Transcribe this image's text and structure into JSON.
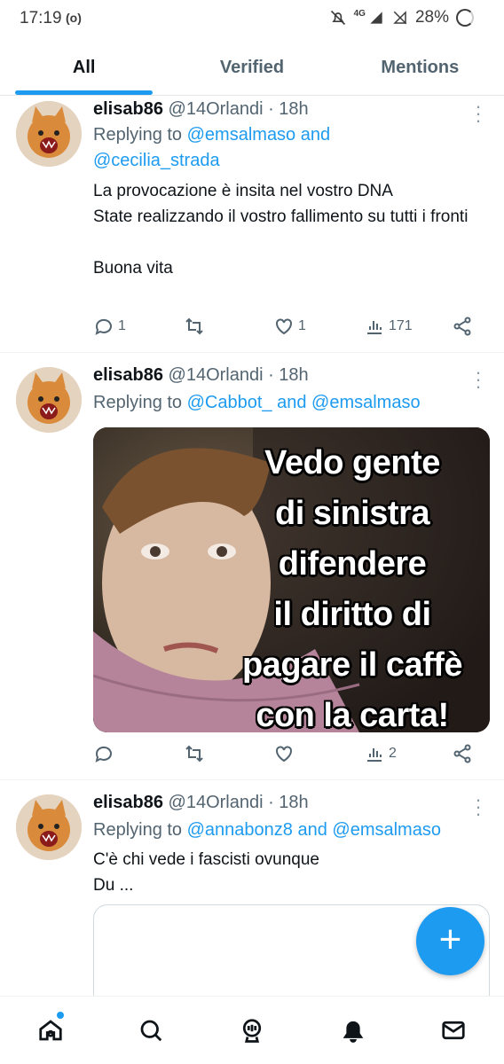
{
  "status": {
    "time": "17:19",
    "cast": "(o)",
    "network": "4G",
    "battery": "28%"
  },
  "tabs": [
    {
      "label": "All",
      "active": true
    },
    {
      "label": "Verified",
      "active": false
    },
    {
      "label": "Mentions",
      "active": false
    }
  ],
  "tweets": [
    {
      "name": "elisab86",
      "meta": "@14Orlandi · 18h",
      "replying_prefix": "Replying to",
      "mentions_line1": "@emsalmaso and",
      "mentions_line2": "@cecilia_strada",
      "text": "La provocazione è insita nel vostro DNA\nState realizzando il vostro fallimento su tutti i fronti\n\nBuona vita",
      "replies": "1",
      "retweets": "",
      "likes": "1",
      "views": "171"
    },
    {
      "name": "elisab86",
      "meta": "@14Orlandi · 18h",
      "replying_prefix": "Replying to",
      "mentions": "@Cabbot_ and @emsalmaso",
      "meme_text": "Vedo gente\ndi sinistra\ndifendere\nil diritto di\npagare il caffè\ncon la carta!",
      "replies": "",
      "retweets": "",
      "likes": "",
      "views": "2"
    },
    {
      "name": "elisab86",
      "meta": "@14Orlandi · 18h",
      "replying_prefix": "Replying to",
      "mentions": "@annabonz8 and @emsalmaso",
      "text": "C'è  chi vede i fascisti ovunque\nDu ..."
    }
  ],
  "fab": {
    "label": "+"
  },
  "colors": {
    "accent": "#1d9bf0",
    "text": "#0f1419",
    "muted": "#536471"
  },
  "nav": [
    "home-icon",
    "search-icon",
    "spaces-icon",
    "notifications-icon",
    "messages-icon"
  ]
}
